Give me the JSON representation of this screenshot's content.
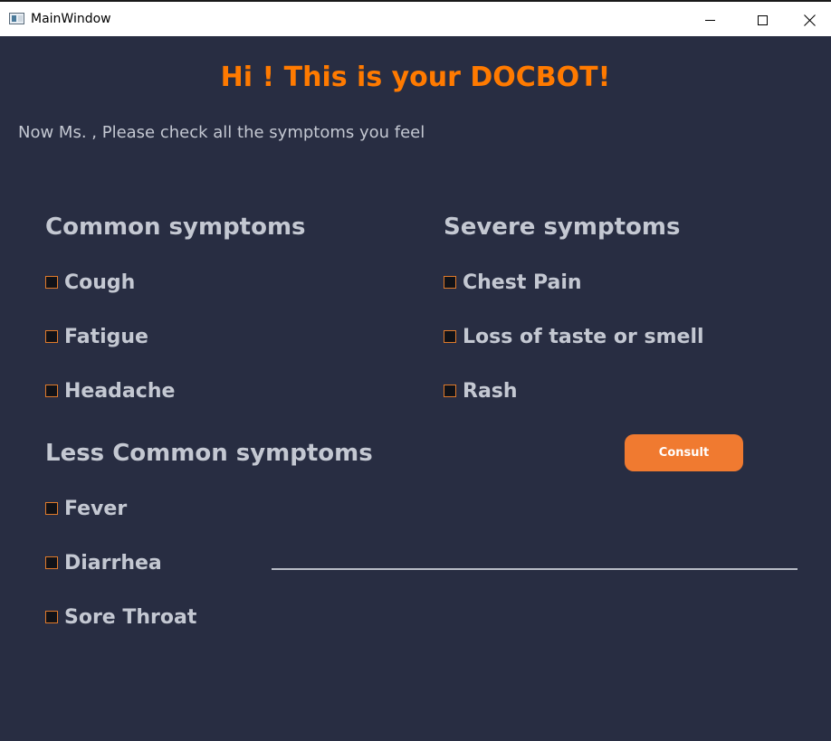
{
  "window": {
    "title": "MainWindow"
  },
  "main": {
    "heading": "Hi ! This is your DOCBOT!",
    "prompt": "Now Ms. , Please check all the symptoms you feel"
  },
  "common": {
    "title": "Common symptoms",
    "items": [
      {
        "label": "Cough",
        "checked": false
      },
      {
        "label": "Fatigue",
        "checked": false
      },
      {
        "label": "Headache",
        "checked": false
      }
    ]
  },
  "severe": {
    "title": "Severe symptoms",
    "items": [
      {
        "label": "Chest Pain",
        "checked": false
      },
      {
        "label": "Loss of taste or smell",
        "checked": false
      },
      {
        "label": "Rash",
        "checked": false
      }
    ]
  },
  "less_common": {
    "title": "Less Common symptoms",
    "items": [
      {
        "label": "Fever",
        "checked": false
      },
      {
        "label": "Diarrhea",
        "checked": false
      },
      {
        "label": "Sore Throat",
        "checked": false
      }
    ]
  },
  "actions": {
    "consult_label": "Consult"
  },
  "colors": {
    "background": "#282d42",
    "accent": "#ff7a00",
    "button": "#f07a30",
    "text": "#c4c8d2"
  }
}
